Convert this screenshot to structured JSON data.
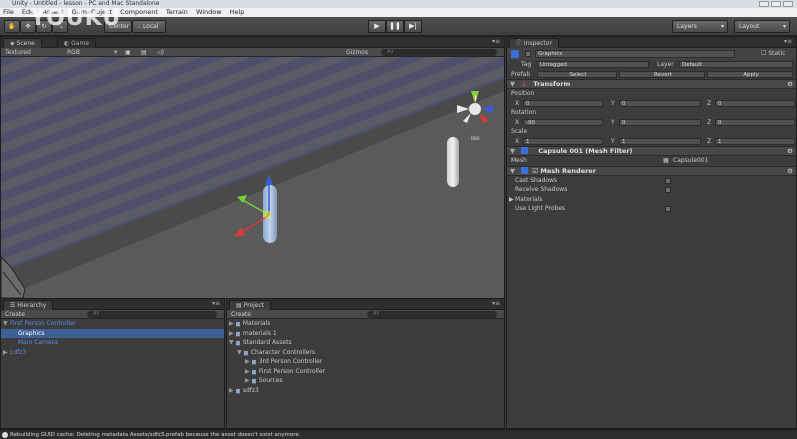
{
  "window": {
    "title": "Unity - Untitled - lesson - PC and Mac Standalone"
  },
  "watermark": "YOUKU",
  "menu": [
    "File",
    "Edit",
    "Assets",
    "GameObject",
    "Component",
    "Terrain",
    "Window",
    "Help"
  ],
  "toolbar": {
    "pivot_label": "Center",
    "local_label": "Local",
    "play_icons": [
      "▶",
      "❚❚",
      "▶|"
    ],
    "layers_label": "Layers",
    "layout_label": "Layout"
  },
  "scene": {
    "tab_scene": "Scene",
    "tab_game": "Game",
    "render_mode": "Textured",
    "color_mode": "RGB",
    "gizmos_label": "Gizmos",
    "search_placeholder": "All",
    "persp_label": "Iso"
  },
  "inspector": {
    "tab": "Inspector",
    "object_name": "Graphics",
    "static_label": "Static",
    "tag_label": "Tag",
    "tag_value": "Untagged",
    "layer_label": "Layer",
    "layer_value": "Default",
    "prefab_label": "Prefab",
    "prefab_select": "Select",
    "prefab_revert": "Revert",
    "prefab_apply": "Apply",
    "transform": {
      "title": "Transform",
      "position_label": "Position",
      "position": {
        "x": "0",
        "y": "0",
        "z": "0"
      },
      "rotation_label": "Rotation",
      "rotation": {
        "x": "-90",
        "y": "0",
        "z": "0"
      },
      "scale_label": "Scale",
      "scale": {
        "x": "1",
        "y": "1",
        "z": "1"
      }
    },
    "mesh_filter": {
      "title": "Capsule 001 (Mesh Filter)",
      "mesh_label": "Mesh",
      "mesh_value": "Capsule001"
    },
    "mesh_renderer": {
      "title": "Mesh Renderer",
      "rows": [
        "Cast Shadows",
        "Receive Shadows",
        "Materials",
        "Use Light Probes"
      ]
    }
  },
  "hierarchy": {
    "tab": "Hierarchy",
    "create_label": "Create",
    "search_placeholder": "All",
    "items": [
      {
        "label": "First Person Controller",
        "indent": 0,
        "selected": false,
        "prefix": "▼"
      },
      {
        "label": "Graphics",
        "indent": 1,
        "selected": true,
        "prefix": ""
      },
      {
        "label": "Main Camera",
        "indent": 1,
        "selected": false,
        "prefix": ""
      },
      {
        "label": "cdfz3",
        "indent": 0,
        "selected": false,
        "prefix": "▶"
      }
    ]
  },
  "project": {
    "tab": "Project",
    "create_label": "Create",
    "search_placeholder": "All",
    "items": [
      {
        "label": "Materials",
        "indent": 0,
        "prefix": "▶"
      },
      {
        "label": "materials 1",
        "indent": 0,
        "prefix": "▶"
      },
      {
        "label": "Standard Assets",
        "indent": 0,
        "prefix": "▼"
      },
      {
        "label": "Character Controllers",
        "indent": 1,
        "prefix": "▼"
      },
      {
        "label": "3rd Person Controller",
        "indent": 2,
        "prefix": "▶"
      },
      {
        "label": "First Person Controller",
        "indent": 2,
        "prefix": "▶"
      },
      {
        "label": "Sources",
        "indent": 2,
        "prefix": "▶"
      },
      {
        "label": "sdfz3",
        "indent": 0,
        "prefix": "▶"
      }
    ]
  },
  "status": {
    "message": "Rebuilding GUID cache: Deleting metadata Assets/sdfz3.prefab because the asset doesn't exist anymore."
  }
}
